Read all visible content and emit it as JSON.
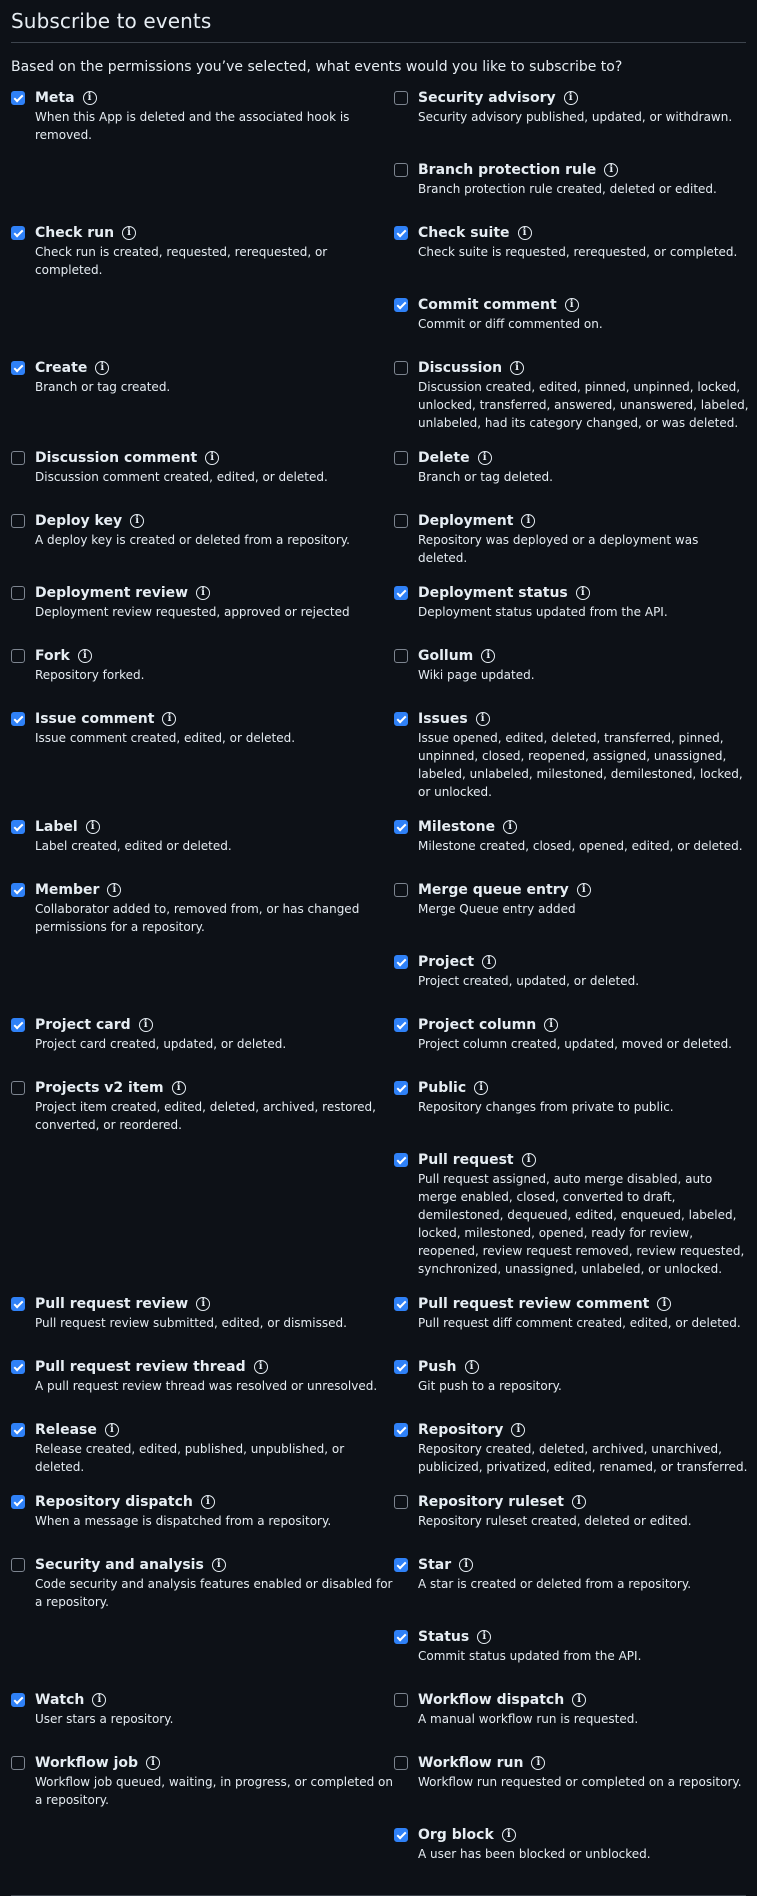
{
  "title": "Subscribe to events",
  "intro": "Based on the permissions you’ve selected, what events would you like to subscribe to?",
  "rows": [
    [
      {
        "name": "Meta",
        "desc": "When this App is deleted and the associated hook is removed.",
        "checked": true
      },
      {
        "name": "Security advisory",
        "desc": "Security advisory published, updated, or withdrawn.",
        "checked": false
      }
    ],
    [
      null,
      {
        "name": "Branch protection rule",
        "desc": "Branch protection rule created, deleted or edited.",
        "checked": false
      }
    ],
    [
      {
        "name": "Check run",
        "desc": "Check run is created, requested, rerequested, or completed.",
        "checked": true
      },
      {
        "name": "Check suite",
        "desc": "Check suite is requested, rerequested, or completed.",
        "checked": true
      }
    ],
    [
      null,
      {
        "name": "Commit comment",
        "desc": "Commit or diff commented on.",
        "checked": true
      }
    ],
    [
      {
        "name": "Create",
        "desc": "Branch or tag created.",
        "checked": true
      },
      {
        "name": "Discussion",
        "desc": "Discussion created, edited, pinned, unpinned, locked, unlocked, transferred, answered, unanswered, labeled, unlabeled, had its category changed, or was deleted.",
        "checked": false
      }
    ],
    [
      {
        "name": "Discussion comment",
        "desc": "Discussion comment created, edited, or deleted.",
        "checked": false
      },
      {
        "name": "Delete",
        "desc": "Branch or tag deleted.",
        "checked": false
      }
    ],
    [
      {
        "name": "Deploy key",
        "desc": "A deploy key is created or deleted from a repository.",
        "checked": false
      },
      {
        "name": "Deployment",
        "desc": "Repository was deployed or a deployment was deleted.",
        "checked": false
      }
    ],
    [
      {
        "name": "Deployment review",
        "desc": "Deployment review requested, approved or rejected",
        "checked": false
      },
      {
        "name": "Deployment status",
        "desc": "Deployment status updated from the API.",
        "checked": true
      }
    ],
    [
      {
        "name": "Fork",
        "desc": "Repository forked.",
        "checked": false
      },
      {
        "name": "Gollum",
        "desc": "Wiki page updated.",
        "checked": false
      }
    ],
    [
      {
        "name": "Issue comment",
        "desc": "Issue comment created, edited, or deleted.",
        "checked": true
      },
      {
        "name": "Issues",
        "desc": "Issue opened, edited, deleted, transferred, pinned, unpinned, closed, reopened, assigned, unassigned, labeled, unlabeled, milestoned, demilestoned, locked, or unlocked.",
        "checked": true
      }
    ],
    [
      {
        "name": "Label",
        "desc": "Label created, edited or deleted.",
        "checked": true
      },
      {
        "name": "Milestone",
        "desc": "Milestone created, closed, opened, edited, or deleted.",
        "checked": true
      }
    ],
    [
      {
        "name": "Member",
        "desc": "Collaborator added to, removed from, or has changed permissions for a repository.",
        "checked": true
      },
      {
        "name": "Merge queue entry",
        "desc": "Merge Queue entry added",
        "checked": false
      }
    ],
    [
      null,
      {
        "name": "Project",
        "desc": "Project created, updated, or deleted.",
        "checked": true
      }
    ],
    [
      {
        "name": "Project card",
        "desc": "Project card created, updated, or deleted.",
        "checked": true
      },
      {
        "name": "Project column",
        "desc": "Project column created, updated, moved or deleted.",
        "checked": true
      }
    ],
    [
      {
        "name": "Projects v2 item",
        "desc": "Project item created, edited, deleted, archived, restored, converted, or reordered.",
        "checked": false
      },
      {
        "name": "Public",
        "desc": "Repository changes from private to public.",
        "checked": true
      }
    ],
    [
      null,
      {
        "name": "Pull request",
        "desc": "Pull request assigned, auto merge disabled, auto merge enabled, closed, converted to draft, demilestoned, dequeued, edited, enqueued, labeled, locked, milestoned, opened, ready for review, reopened, review request removed, review requested, synchronized, unassigned, unlabeled, or unlocked.",
        "checked": true
      }
    ],
    [
      {
        "name": "Pull request review",
        "desc": "Pull request review submitted, edited, or dismissed.",
        "checked": true
      },
      {
        "name": "Pull request review comment",
        "desc": "Pull request diff comment created, edited, or deleted.",
        "checked": true
      }
    ],
    [
      {
        "name": "Pull request review thread",
        "desc": "A pull request review thread was resolved or unresolved.",
        "checked": true
      },
      {
        "name": "Push",
        "desc": "Git push to a repository.",
        "checked": true
      }
    ],
    [
      {
        "name": "Release",
        "desc": "Release created, edited, published, unpublished, or deleted.",
        "checked": true
      },
      {
        "name": "Repository",
        "desc": "Repository created, deleted, archived, unarchived, publicized, privatized, edited, renamed, or transferred.",
        "checked": true
      }
    ],
    [
      {
        "name": "Repository dispatch",
        "desc": "When a message is dispatched from a repository.",
        "checked": true
      },
      {
        "name": "Repository ruleset",
        "desc": "Repository ruleset created, deleted or edited.",
        "checked": false
      }
    ],
    [
      {
        "name": "Security and analysis",
        "desc": "Code security and analysis features enabled or disabled for a repository.",
        "checked": false
      },
      {
        "name": "Star",
        "desc": "A star is created or deleted from a repository.",
        "checked": true
      }
    ],
    [
      null,
      {
        "name": "Status",
        "desc": "Commit status updated from the API.",
        "checked": true
      }
    ],
    [
      {
        "name": "Watch",
        "desc": "User stars a repository.",
        "checked": true
      },
      {
        "name": "Workflow dispatch",
        "desc": "A manual workflow run is requested.",
        "checked": false
      }
    ],
    [
      {
        "name": "Workflow job",
        "desc": "Workflow job queued, waiting, in progress, or completed on a repository.",
        "checked": false
      },
      {
        "name": "Workflow run",
        "desc": "Workflow run requested or completed on a repository.",
        "checked": false
      }
    ],
    [
      null,
      {
        "name": "Org block",
        "desc": "A user has been blocked or unblocked.",
        "checked": true
      }
    ]
  ]
}
